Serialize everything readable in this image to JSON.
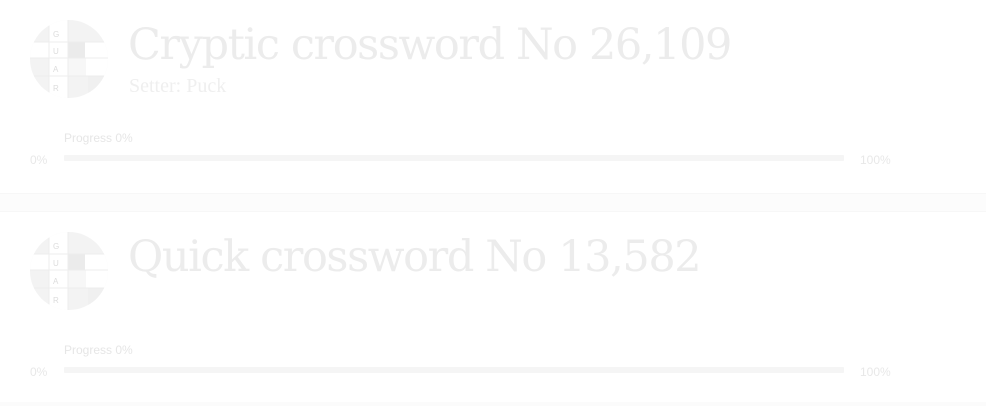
{
  "crosswords": [
    {
      "title": "Cryptic crossword No 26,109",
      "setter": "Setter: Puck",
      "progress_label": "Progress 0%",
      "progress": 0,
      "min_label": "0%",
      "max_label": "100%"
    },
    {
      "title": "Quick crossword No 13,582",
      "setter": "",
      "progress_label": "Progress 0%",
      "progress": 0,
      "min_label": "0%",
      "max_label": "100%"
    }
  ],
  "logo": {
    "icon": "guardian-crossword-logo-icon",
    "letters": [
      "G",
      "U",
      "A",
      "R"
    ]
  },
  "colors": {
    "text": "#ececec",
    "track": "#f5f5f5",
    "separator": "#fcfcfc"
  }
}
